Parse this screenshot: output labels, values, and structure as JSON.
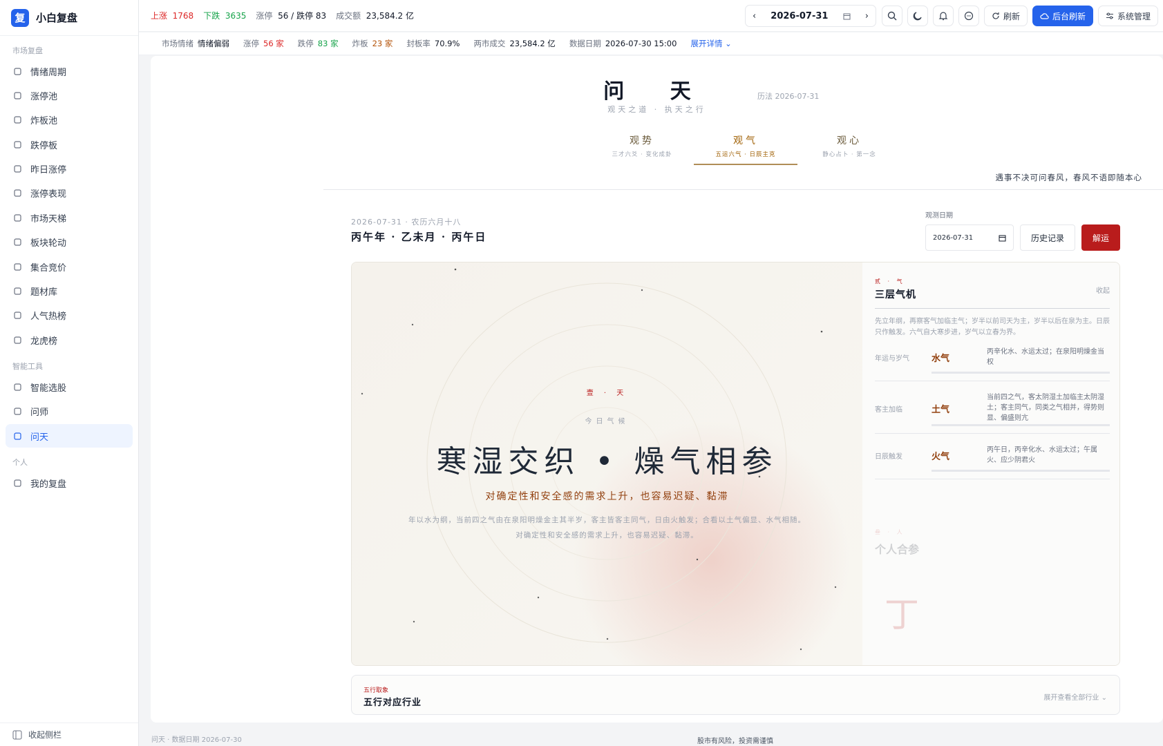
{
  "app": {
    "logo_char": "复",
    "name": "小白复盘"
  },
  "sidebar": {
    "groups": [
      {
        "label": "市场复盘",
        "items": [
          "情绪周期",
          "涨停池",
          "炸板池",
          "跌停板",
          "昨日涨停",
          "涨停表现",
          "市场天梯",
          "板块轮动",
          "集合竞价",
          "题材库",
          "人气热榜",
          "龙虎榜"
        ]
      },
      {
        "label": "智能工具",
        "items": [
          "智能选股",
          "问师",
          "问天"
        ]
      },
      {
        "label": "个人",
        "items": [
          "我的复盘"
        ]
      }
    ],
    "active_item": "问天",
    "collapse_label": "收起侧栏"
  },
  "topbar": {
    "up_label": "上涨",
    "up_value": "1768",
    "down_label": "下跌",
    "down_value": "3635",
    "limit_label": "涨停",
    "limit_value": "56 / 跌停 83",
    "turnover_label": "成交额",
    "turnover_value": "23,584.2 亿",
    "date": "2026-07-31",
    "refresh_label": "刷新",
    "bg_refresh_label": "后台刷新",
    "sys_label": "系统管理"
  },
  "subbar": {
    "mood_label": "市场情绪",
    "mood_value": "情绪偏弱",
    "zt_label": "涨停",
    "zt_value": "56 家",
    "dt_label": "跌停",
    "dt_value": "83 家",
    "zb_label": "炸板",
    "zb_value": "23 家",
    "fb_label": "封板率",
    "fb_value": "70.9%",
    "cj_label": "两市成交",
    "cj_value": "23,584.2 亿",
    "date_label": "数据日期",
    "date_value": "2026-07-30 15:00",
    "expand_label": "展开详情"
  },
  "page": {
    "title": "问 天",
    "calendar": "历法 2026-07-31",
    "motto": "观天之道 · 执天之行",
    "tabs": [
      {
        "name": "观势",
        "sub": "三才六爻 · 变化成卦"
      },
      {
        "name": "观气",
        "sub": "五运六气 · 日辰主克"
      },
      {
        "name": "观心",
        "sub": "静心占卜 · 第一念"
      }
    ],
    "proverb": "遇事不决可问春风，春风不语即随本心",
    "date_meta": "2026-07-31 · 农历六月十八",
    "ganzhi": "丙午年 · 乙未月 · 丙午日",
    "obs_label": "观测日期",
    "obs_value": "2026-07-31",
    "history_btn": "历史记录",
    "jie_btn": "解运"
  },
  "hero": {
    "tag": "壹 · 天",
    "sub": "今日气候",
    "main": "寒湿交织 • 燥气相参",
    "line": "对确定性和安全感的需求上升，也容易迟疑、黏滞",
    "desc": "年以水为纲，当前四之气由在泉阳明燥金主其半岁，客主皆客主同气，日由火触发；合看以土气偏显、水气相随。对确定性和安全感的需求上升，也容易迟疑、黏滞。"
  },
  "side": {
    "tag": "贰 · 气",
    "title": "三层气机",
    "fold": "收起",
    "desc": "先立年纲，再察客气加临主气；岁半以前司天为主，岁半以后在泉为主。日辰只作触发。六气自大寒步进，岁气以立春为界。",
    "rows": [
      {
        "label": "年运与岁气",
        "value": "水气",
        "desc": "丙辛化水、水运太过；在泉阳明燥金当权"
      },
      {
        "label": "客主加临",
        "value": "土气",
        "desc": "当前四之气，客太阴湿土加临主太阴湿土；客主同气，同类之气相并，得势则显、偏盛则亢"
      },
      {
        "label": "日辰触发",
        "value": "火气",
        "desc": "丙午日，丙辛化水、水运太过；午属火、应少阴君火"
      }
    ],
    "faded_tag": "叁 · 人",
    "faded_title": "个人合参",
    "faded_char": "丁"
  },
  "wuxing": {
    "tag": "五行取象",
    "title": "五行对应行业",
    "more": "展开查看全部行业"
  },
  "footer": {
    "left": "问天 · 数据日期 2026-07-30",
    "right": "股市有风险，投资需谨慎"
  }
}
